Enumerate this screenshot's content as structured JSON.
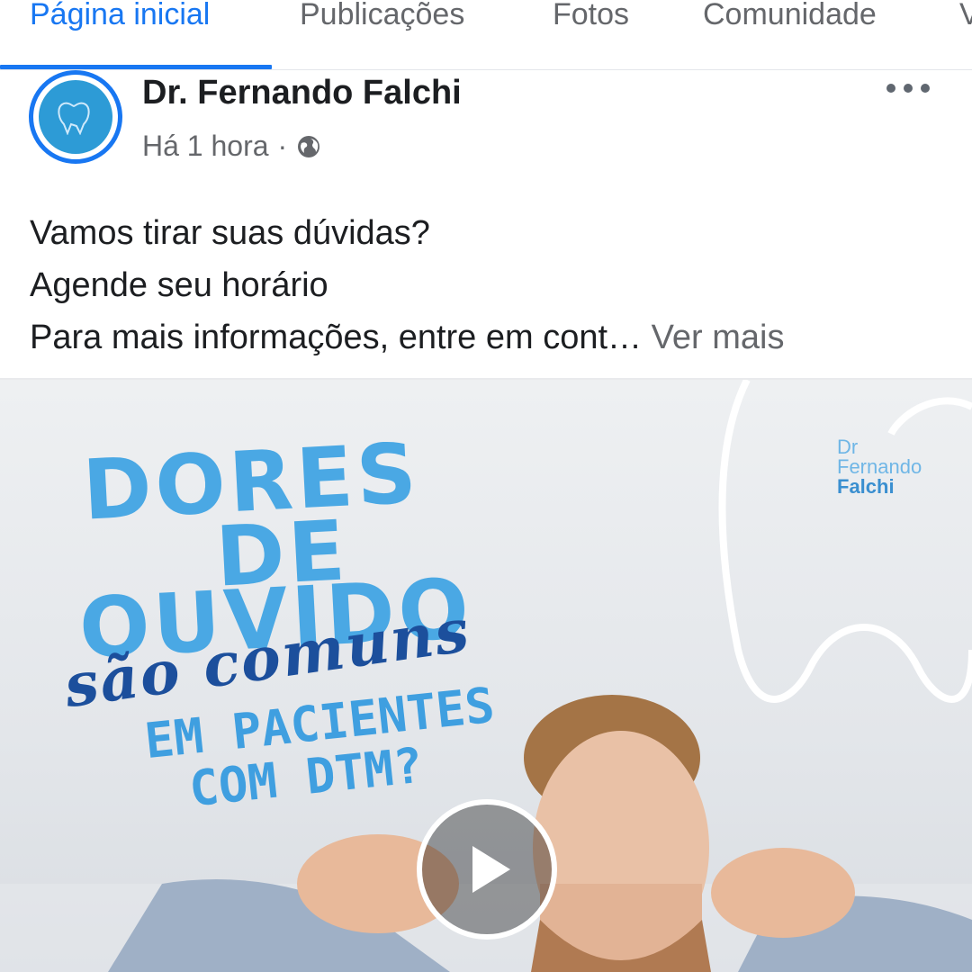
{
  "tabs": [
    {
      "label": "Página inicial",
      "active": true
    },
    {
      "label": "Publicações",
      "active": false
    },
    {
      "label": "Fotos",
      "active": false
    },
    {
      "label": "Comunidade",
      "active": false
    }
  ],
  "post": {
    "author": "Dr. Fernando Falchi",
    "time": "Há 1 hora",
    "separator": "·",
    "privacy_icon": "globe-icon",
    "text_lines": [
      "Vamos tirar suas dúvidas?",
      "Agende seu horário",
      "Para mais informações, entre em cont…"
    ],
    "see_more": "Ver mais"
  },
  "media": {
    "headline": [
      "DORES",
      "DE",
      "OUVIDO"
    ],
    "script": "são comuns",
    "subtitle": [
      "EM PACIENTES",
      "COM DTM?"
    ],
    "brand": [
      "Dr",
      "Fernando",
      "Falchi"
    ],
    "play_icon": "play-icon"
  },
  "colors": {
    "accent": "#1877f2",
    "muted": "#65676b",
    "headline_blue": "#4aa8e4",
    "script_navy": "#1c4f9c"
  }
}
